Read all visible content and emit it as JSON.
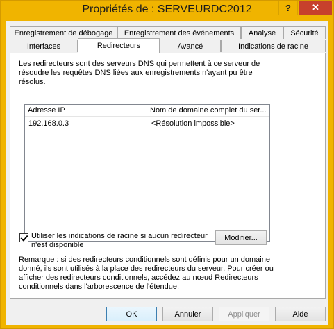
{
  "window": {
    "title": "Propriétés de : SERVEURDC2012",
    "help_label": "?",
    "close_label": "✕"
  },
  "tabs_row1": [
    {
      "label": "Enregistrement de débogage"
    },
    {
      "label": "Enregistrement des événements"
    },
    {
      "label": "Analyse"
    },
    {
      "label": "Sécurité"
    }
  ],
  "tabs_row2": [
    {
      "label": "Interfaces"
    },
    {
      "label": "Redirecteurs"
    },
    {
      "label": "Avancé"
    },
    {
      "label": "Indications de racine"
    }
  ],
  "active_tab": "Redirecteurs",
  "description": [
    "Les redirecteurs sont des serveurs DNS qui permettent à ce serveur de",
    "résoudre les requêtes DNS liées aux enregistrements n'ayant pu être",
    "résolus."
  ],
  "list": {
    "columns": [
      "Adresse IP",
      "Nom de domaine complet du ser..."
    ],
    "rows": [
      {
        "ip": "192.168.0.3",
        "fqdn": "<Résolution impossible>"
      }
    ]
  },
  "checkbox": {
    "checked": true,
    "label_lines": [
      "Utiliser les indications de racine si aucun redirecteur",
      "n'est disponible"
    ]
  },
  "modify_button": "Modifier...",
  "remark": [
    "Remarque : si des redirecteurs conditionnels sont définis pour un domaine",
    "donné, ils sont utilisés à la place des redirecteurs du serveur. Pour créer ou",
    "afficher des redirecteurs conditionnels, accédez au nœud Redirecteurs",
    "conditionnels dans l'arborescence de l'étendue."
  ],
  "buttons": {
    "ok": "OK",
    "cancel": "Annuler",
    "apply": "Appliquer",
    "help": "Aide"
  },
  "colors": {
    "titlebar": "#f0b400",
    "close": "#c7402c"
  }
}
